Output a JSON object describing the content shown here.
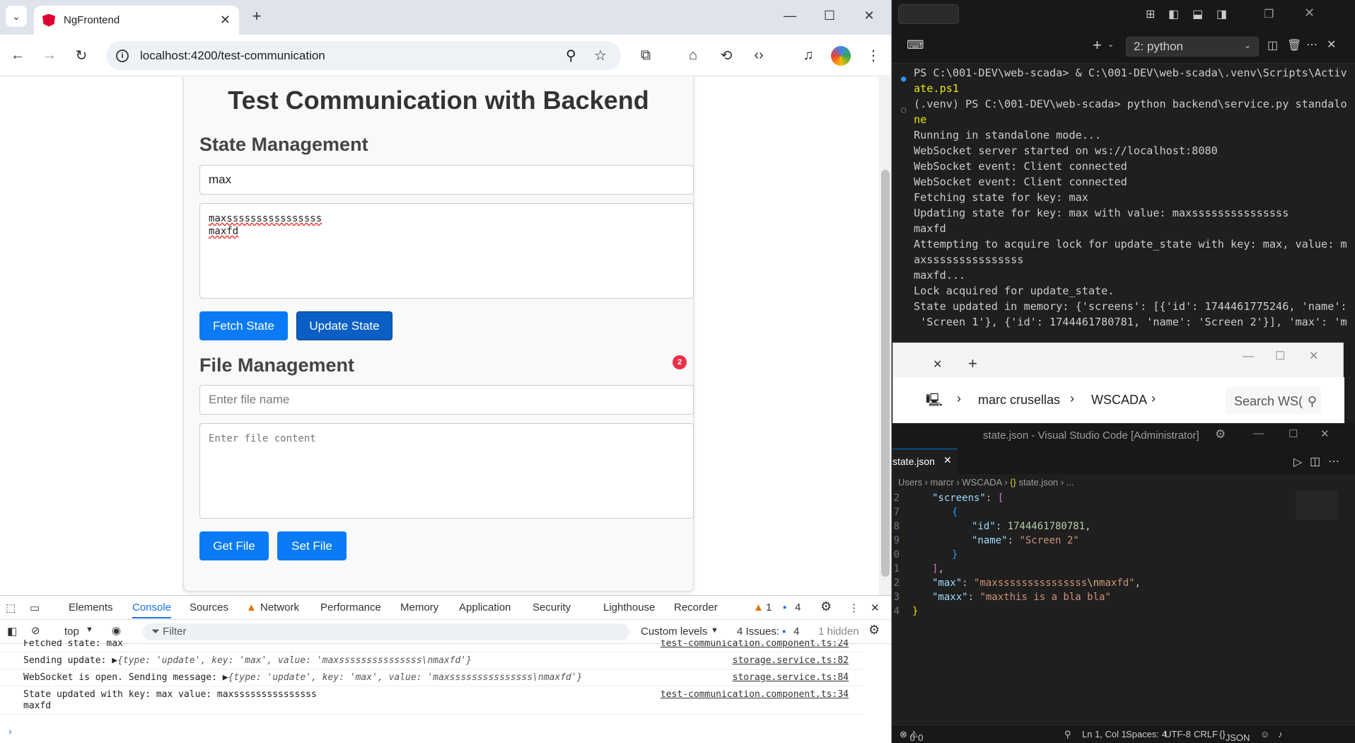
{
  "browser": {
    "tab_title": "NgFrontend",
    "url": "localhost:4200/test-communication",
    "page": {
      "title": "Test Communication with Backend",
      "state_heading": "State Management",
      "state_key_value": "max",
      "state_value_lines": [
        "maxssssssssssssssss",
        "maxfd"
      ],
      "fetch_label": "Fetch State",
      "update_label": "Update State",
      "issue_count": "2",
      "file_heading": "File Management",
      "file_name_placeholder": "Enter file name",
      "file_content_placeholder": "Enter file content",
      "get_file_label": "Get File",
      "set_file_label": "Set File"
    }
  },
  "devtools": {
    "tabs": [
      "Elements",
      "Console",
      "Sources",
      "Network",
      "Performance",
      "Memory",
      "Application",
      "Security",
      "Lighthouse",
      "Recorder"
    ],
    "warn_count": "1",
    "msg_count": "4",
    "context": "top",
    "filter_placeholder": "Filter",
    "levels": "Custom levels",
    "issues_label": "4 Issues:",
    "issues_count": "4",
    "hidden": "1 hidden",
    "logs": [
      {
        "msg": "Fetched state: max",
        "src": "test-communication.component.ts:24"
      },
      {
        "prefix": "Sending update: ",
        "obj": "{type: 'update', key: 'max', value: 'maxsssssssssssssss\\nmaxfd'}",
        "src": "storage.service.ts:82"
      },
      {
        "prefix": "WebSocket is open. Sending message: ",
        "obj": "{type: 'update', key: 'max', value: 'maxsssssssssssssss\\nmaxfd'}",
        "src": "storage.service.ts:84"
      },
      {
        "msg": "State updated with key: max value: maxsssssssssssssss",
        "msg2": "maxfd",
        "src": "test-communication.component.ts:34"
      }
    ]
  },
  "terminal": {
    "dropdown": "2: python",
    "lines": [
      "PS C:\\001-DEV\\web-scada> & C:\\001-DEV\\web-scada\\.venv\\Scripts\\Activ",
      "ate.ps1",
      "(.venv) PS C:\\001-DEV\\web-scada> python backend\\service.py standalo",
      "ne",
      "Running in standalone mode...",
      "WebSocket server started on ws://localhost:8080",
      "WebSocket event: Client connected",
      "WebSocket event: Client connected",
      "Fetching state for key: max",
      "Updating state for key: max with value: maxsssssssssssssss",
      "maxfd",
      "Attempting to acquire lock for update_state with key: max, value: m",
      "axsssssssssssssss",
      "maxfd...",
      "Lock acquired for update_state.",
      "State updated in memory: {'screens': [{'id': 1744461775246, 'name':",
      " 'Screen 1'}, {'id': 1744461780781, 'name': 'Screen 2'}], 'max': 'm"
    ]
  },
  "explorer": {
    "crumbs": [
      "marc crusellas",
      "WSCADA"
    ],
    "search_placeholder": "Search WS("
  },
  "vscode": {
    "title": "state.json - Visual Studio Code [Administrator]",
    "tab": "state.json",
    "crumb": [
      "Users",
      "marcr",
      "WSCADA",
      "state.json",
      "..."
    ],
    "status": {
      "errors": "0",
      "warnings": "0",
      "position": "Ln 1, Col 1",
      "spaces": "Spaces: 4",
      "encoding": "UTF-8",
      "eol": "CRLF",
      "lang": "JSON"
    }
  }
}
